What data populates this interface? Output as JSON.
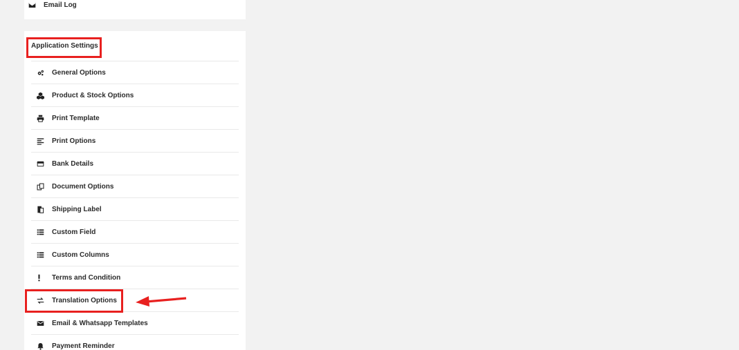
{
  "top_card": {
    "email_log_label": "Email Log",
    "email_log_icon": "envelope-icon"
  },
  "settings": {
    "title": "Application Settings",
    "items": [
      {
        "label": "General Options",
        "icon": "gears-icon"
      },
      {
        "label": "Product & Stock Options",
        "icon": "cubes-icon"
      },
      {
        "label": "Print Template",
        "icon": "printer-icon"
      },
      {
        "label": "Print Options",
        "icon": "align-left-icon"
      },
      {
        "label": "Bank Details",
        "icon": "credit-card-icon"
      },
      {
        "label": "Document Options",
        "icon": "copy-icon"
      },
      {
        "label": "Shipping Label",
        "icon": "clipboard-icon"
      },
      {
        "label": "Custom Field",
        "icon": "list-icon"
      },
      {
        "label": "Custom Columns",
        "icon": "list-icon"
      },
      {
        "label": "Terms and Condition",
        "icon": "exclamation-icon"
      },
      {
        "label": "Translation Options",
        "icon": "exchange-icon"
      },
      {
        "label": "Email & Whatsapp Templates",
        "icon": "envelope-icon"
      },
      {
        "label": "Payment Reminder",
        "icon": "bell-icon"
      }
    ]
  },
  "annotation": {
    "highlight_color": "#e8201f",
    "highlighted_items": [
      "Application Settings",
      "Translation Options"
    ]
  }
}
